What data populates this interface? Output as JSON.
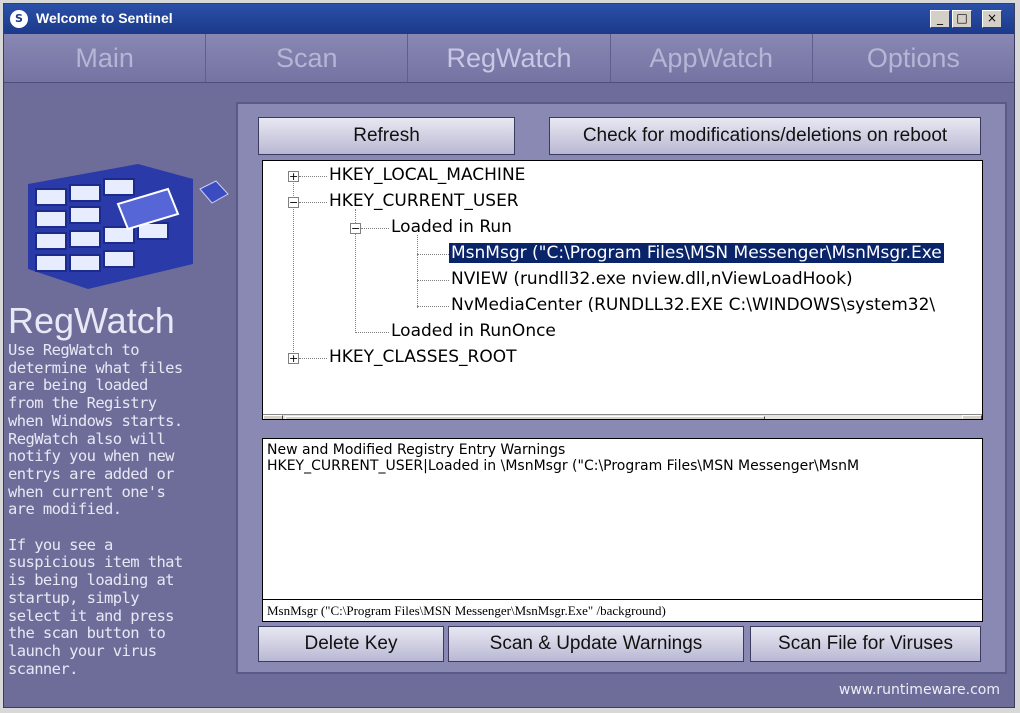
{
  "window": {
    "title": "Welcome to Sentinel",
    "app_icon_glyph": "S",
    "controls": [
      "_",
      "□",
      "×"
    ]
  },
  "nav": {
    "tabs": [
      "Main",
      "Scan",
      "RegWatch",
      "AppWatch",
      "Options"
    ],
    "active": "RegWatch"
  },
  "sidebar": {
    "title": "RegWatch",
    "description": "Use RegWatch to\ndetermine what files\nare being loaded\nfrom the Registry\nwhen Windows starts.\nRegWatch also will\nnotify you when new\nentrys are added or\nwhen current one's\nare modified.\n\nIf you see a\nsuspicious item that\nis being loading at\nstartup, simply\nselect it and press\nthe scan button to\nlaunch your virus\nscanner."
  },
  "buttons": {
    "refresh": "Refresh",
    "check_reboot": "Check for modifications/deletions on reboot",
    "delete_key": "Delete Key",
    "scan_update": "Scan & Update Warnings",
    "scan_file": "Scan File for Viruses"
  },
  "tree": {
    "hklm": "HKEY_LOCAL_MACHINE",
    "hkcu": "HKEY_CURRENT_USER",
    "loaded_run": "Loaded in Run",
    "entry1": "MsnMsgr (\"C:\\Program Files\\MSN Messenger\\MsnMsgr.Exe",
    "entry2": "NVIEW (rundll32.exe nview.dll,nViewLoadHook)",
    "entry3": "NvMediaCenter (RUNDLL32.EXE C:\\WINDOWS\\system32\\",
    "loaded_runonce": "Loaded in RunOnce",
    "hkcr": "HKEY_CLASSES_ROOT",
    "selected": "entry1"
  },
  "warnings": {
    "header": "New and Modified Registry Entry Warnings",
    "line1": "HKEY_CURRENT_USER|Loaded in \\MsnMsgr (\"C:\\Program Files\\MSN Messenger\\MsnM"
  },
  "status": {
    "text": "MsnMsgr (\"C:\\Program Files\\MSN Messenger\\MsnMsgr.Exe\" /background)"
  },
  "footer": {
    "url": "www.runtimeware.com"
  },
  "colors": {
    "background": "#6e6d9a",
    "titlebar": "#1b3a8a",
    "selection": "#0a246a"
  }
}
